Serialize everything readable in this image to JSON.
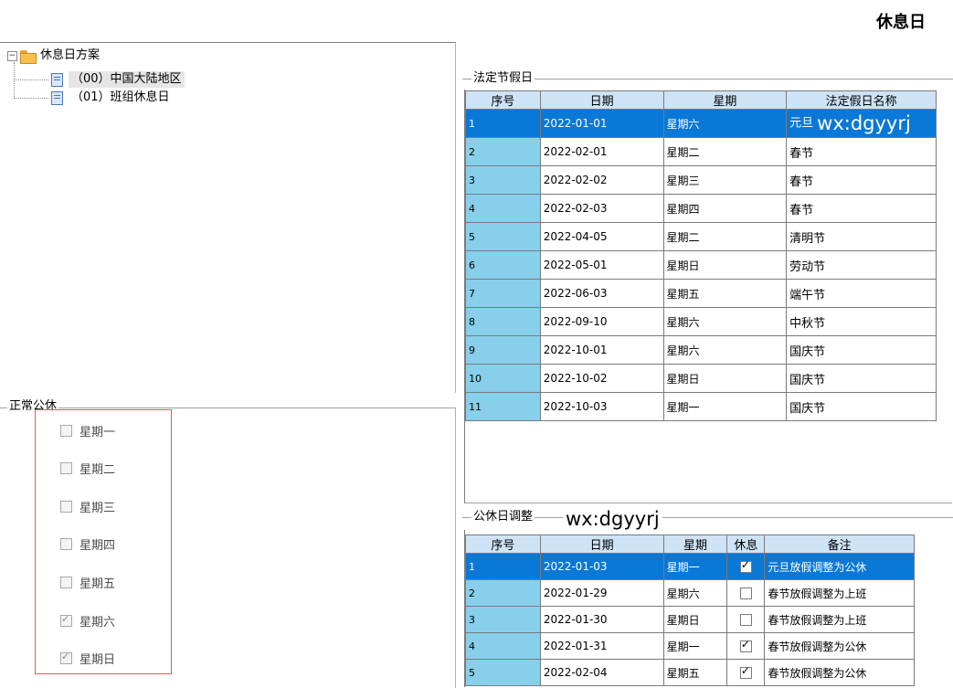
{
  "page_title": "休息日",
  "tree": {
    "root_label": "休息日方案",
    "items": [
      {
        "label": "（00）中国大陆地区"
      },
      {
        "label": "（01）班组休息日"
      }
    ]
  },
  "weekday_group": {
    "title": "正常公休",
    "days": [
      {
        "label": "星期一",
        "checked": false
      },
      {
        "label": "星期二",
        "checked": false
      },
      {
        "label": "星期三",
        "checked": false
      },
      {
        "label": "星期四",
        "checked": false
      },
      {
        "label": "星期五",
        "checked": false
      },
      {
        "label": "星期六",
        "checked": true
      },
      {
        "label": "星期日",
        "checked": true
      }
    ]
  },
  "legal_holidays": {
    "title": "法定节假日",
    "headers": [
      "序号",
      "日期",
      "星期",
      "法定假日名称"
    ],
    "rows": [
      {
        "seq": "1",
        "date": "2022-01-01",
        "weekday": "星期六",
        "name": "元旦"
      },
      {
        "seq": "2",
        "date": "2022-02-01",
        "weekday": "星期二",
        "name": "春节"
      },
      {
        "seq": "3",
        "date": "2022-02-02",
        "weekday": "星期三",
        "name": "春节"
      },
      {
        "seq": "4",
        "date": "2022-02-03",
        "weekday": "星期四",
        "name": "春节"
      },
      {
        "seq": "5",
        "date": "2022-04-05",
        "weekday": "星期二",
        "name": "清明节"
      },
      {
        "seq": "6",
        "date": "2022-05-01",
        "weekday": "星期日",
        "name": "劳动节"
      },
      {
        "seq": "7",
        "date": "2022-06-03",
        "weekday": "星期五",
        "name": "端午节"
      },
      {
        "seq": "8",
        "date": "2022-09-10",
        "weekday": "星期六",
        "name": "中秋节"
      },
      {
        "seq": "9",
        "date": "2022-10-01",
        "weekday": "星期六",
        "name": "国庆节"
      },
      {
        "seq": "10",
        "date": "2022-10-02",
        "weekday": "星期日",
        "name": "国庆节"
      },
      {
        "seq": "11",
        "date": "2022-10-03",
        "weekday": "星期一",
        "name": "国庆节"
      }
    ],
    "selected_index": 0,
    "watermark": "wx:dgyyrj"
  },
  "adjustments": {
    "title": "公休日调整",
    "watermark": "wx:dgyyrj",
    "headers": [
      "序号",
      "日期",
      "星期",
      "休息",
      "备注"
    ],
    "rows": [
      {
        "seq": "1",
        "date": "2022-01-03",
        "weekday": "星期一",
        "rest": true,
        "note": "元旦放假调整为公休"
      },
      {
        "seq": "2",
        "date": "2022-01-29",
        "weekday": "星期六",
        "rest": false,
        "note": "春节放假调整为上班"
      },
      {
        "seq": "3",
        "date": "2022-01-30",
        "weekday": "星期日",
        "rest": false,
        "note": "春节放假调整为上班"
      },
      {
        "seq": "4",
        "date": "2022-01-31",
        "weekday": "星期一",
        "rest": true,
        "note": "春节放假调整为公休"
      },
      {
        "seq": "5",
        "date": "2022-02-04",
        "weekday": "星期五",
        "rest": true,
        "note": "春节放假调整为公休"
      }
    ],
    "selected_index": 0
  },
  "colors": {
    "selected_row": "#0a78d7",
    "seq_column": "#87cfea",
    "header_bg": "#cfe3f6",
    "weekday_box_border": "#e05a5a"
  }
}
